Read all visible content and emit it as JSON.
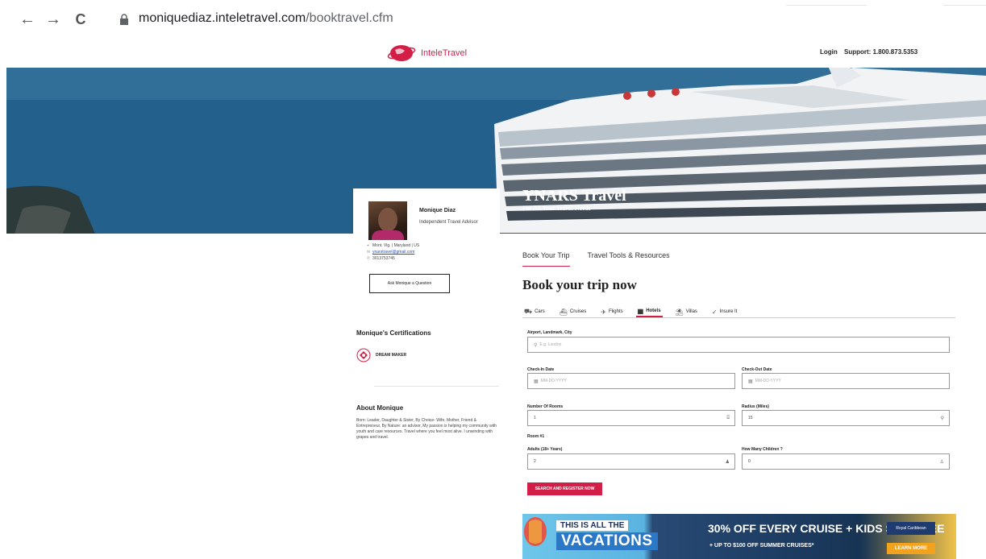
{
  "browser": {
    "url_domain": "moniquediaz.inteletravel.com",
    "url_path": "/booktravel.cfm",
    "back_icon": "←",
    "forward_icon": "→",
    "reload_icon": "C"
  },
  "header": {
    "logo_text": "InteleTravel",
    "login": "Login",
    "support": "Support: 1.800.873.5353"
  },
  "hero": {
    "agency_name": "YNARS Travel",
    "tagline": "For All Your Travel Needs"
  },
  "profile": {
    "name": "Monique Diaz",
    "role": "Independent Travel Advisor",
    "location": "Mont. Vlg. | Maryland | US",
    "email": "ynarstravel@gmail.com",
    "phone": "3013753745",
    "ask_button": "Ask Monique a Question"
  },
  "certifications": {
    "title": "Monique's Certifications",
    "items": [
      "DREAM MAKER"
    ]
  },
  "about": {
    "title": "About Monique",
    "text": "Born: Leader, Daughter & Sister, By Choice- Wife, Mother, Friend & Entrepreneur, By Nature: an advisor, My passion is helping my community with youth and care resources. Travel where you feel most alive. I unwinding with grapes and travel."
  },
  "main_tabs": [
    "Book Your Trip",
    "Travel Tools & Resources"
  ],
  "book_title": "Book your trip now",
  "product_tabs": [
    {
      "label": "Cars",
      "icon": "car-icon",
      "glyph": "⛟"
    },
    {
      "label": "Cruises",
      "icon": "ship-icon",
      "glyph": "⛴"
    },
    {
      "label": "Flights",
      "icon": "plane-icon",
      "glyph": "✈"
    },
    {
      "label": "Hotels",
      "icon": "hotel-icon",
      "glyph": "▦"
    },
    {
      "label": "Villas",
      "icon": "umbrella-icon",
      "glyph": "⛱"
    },
    {
      "label": "Insure It",
      "icon": "check-icon",
      "glyph": "✓"
    }
  ],
  "form": {
    "destination_label": "Airport, Landmark, City",
    "destination_placeholder": "E.g. London",
    "checkin_label": "Check-In Date",
    "checkin_placeholder": "MM-DD-YYYY",
    "checkout_label": "Check-Out Date",
    "checkout_placeholder": "MM-DD-YYYY",
    "rooms_label": "Number Of Rooms",
    "rooms_value": "1",
    "radius_label": "Radius (Miles)",
    "radius_value": "15",
    "room_heading": "Room #1",
    "adults_label": "Adults (18+ Years)",
    "adults_value": "2",
    "children_label": "How Many Children ?",
    "children_value": "0",
    "search_button": "SEARCH AND REGISTER NOW"
  },
  "banner": {
    "line1": "THIS IS ALL THE",
    "line2": "VACATIONS",
    "offer": "30% OFF EVERY CRUISE + KIDS SAIL FREE",
    "sub": "+ UP TO $100 OFF SUMMER CRUISES*",
    "brand": "Royal Caribbean",
    "cta": "LEARN MORE"
  },
  "colors": {
    "accent": "#d31e47"
  }
}
